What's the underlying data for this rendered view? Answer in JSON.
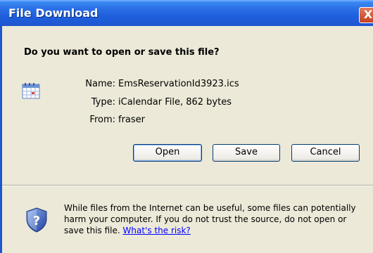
{
  "window": {
    "title": "File Download",
    "close_glyph": "X"
  },
  "dialog": {
    "question": "Do you want to open or save this file?",
    "file": {
      "name_label": "Name:",
      "name_value": "EmsReservationId3923.ics",
      "type_label": "Type:",
      "type_value": "iCalendar File, 862 bytes",
      "from_label": "From:",
      "from_value": "fraser",
      "icon": "calendar-file-icon"
    },
    "buttons": {
      "open": "Open",
      "save": "Save",
      "cancel": "Cancel"
    },
    "warning": {
      "icon": "shield-question-icon",
      "text": "While files from the Internet can be useful, some files can potentially harm your computer. If you do not trust the source, do not open or save this file.",
      "link": "What's the risk?"
    }
  },
  "colors": {
    "titlebar": "#1f5fdc",
    "dialog_bg": "#ece9d8",
    "link": "#0000ff",
    "button_border": "#003c74"
  }
}
